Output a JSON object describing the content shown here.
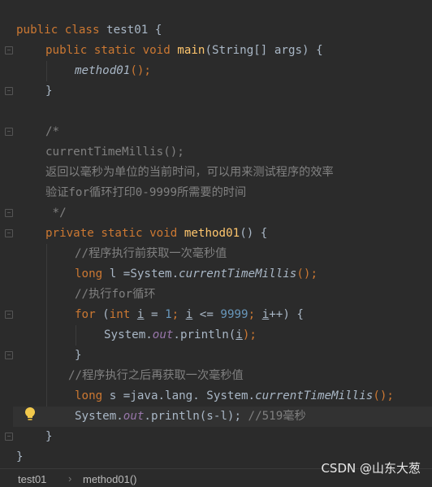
{
  "editor": {
    "lines": {
      "l1": {
        "t1": "public class ",
        "t2": "test01 {"
      },
      "l2": {
        "t1": "public static void ",
        "t2": "main",
        "t3": "(String[] args) {"
      },
      "l3": {
        "t1": "method01",
        "t2": "();"
      },
      "l4": {
        "t1": "}"
      },
      "l6": {
        "t1": "/*"
      },
      "l7": {
        "t1": "currentTimeMillis();"
      },
      "l8": {
        "t1": "返回以毫秒为单位的当前时间，可以用来测试程序的效率"
      },
      "l9": {
        "t1": "验证for循环打印0-9999所需要的时间"
      },
      "l10": {
        "t1": " */"
      },
      "l11": {
        "t1": "private static void ",
        "t2": "method01",
        "t3": "() {"
      },
      "l12": {
        "t1": "//程序执行前获取一次毫秒值"
      },
      "l13": {
        "t1": "long ",
        "t2": "l =System.",
        "t3": "currentTimeMillis",
        "t4": "();"
      },
      "l14": {
        "t1": "//执行for循环"
      },
      "l15": {
        "t1": "for ",
        "t2": "(",
        "t3": "int ",
        "t4": "i",
        "t5": " = ",
        "t6": "1",
        "t7": "; ",
        "t8": "i",
        "t9": " <= ",
        "t10": "9999",
        "t11": "; ",
        "t12": "i",
        "t13": "++) {"
      },
      "l16": {
        "t1": "System.",
        "t2": "out",
        "t3": ".println(",
        "t4": "i",
        "t5": ");"
      },
      "l17": {
        "t1": "}"
      },
      "l18": {
        "t1": "//程序执行之后再获取一次毫秒值"
      },
      "l19": {
        "t1": "long ",
        "t2": "s =java.lang. System.",
        "t3": "currentTimeMillis",
        "t4": "();"
      },
      "l20": {
        "t1": "System.",
        "t2": "out",
        "t3": ".println(s-l); ",
        "t4": "//519毫秒"
      },
      "l21": {
        "t1": "}"
      },
      "l22": {
        "t1": "}"
      }
    }
  },
  "breadcrumb": {
    "class_name": "test01",
    "method_name": "method01()"
  },
  "watermark": "CSDN @山东大葱",
  "colors": {
    "background": "#2b2b2b",
    "keyword": "#cc7832",
    "method": "#ffc66d",
    "static_field": "#9876aa",
    "number": "#6897bb",
    "comment": "#808080",
    "text": "#a9b7c6"
  }
}
